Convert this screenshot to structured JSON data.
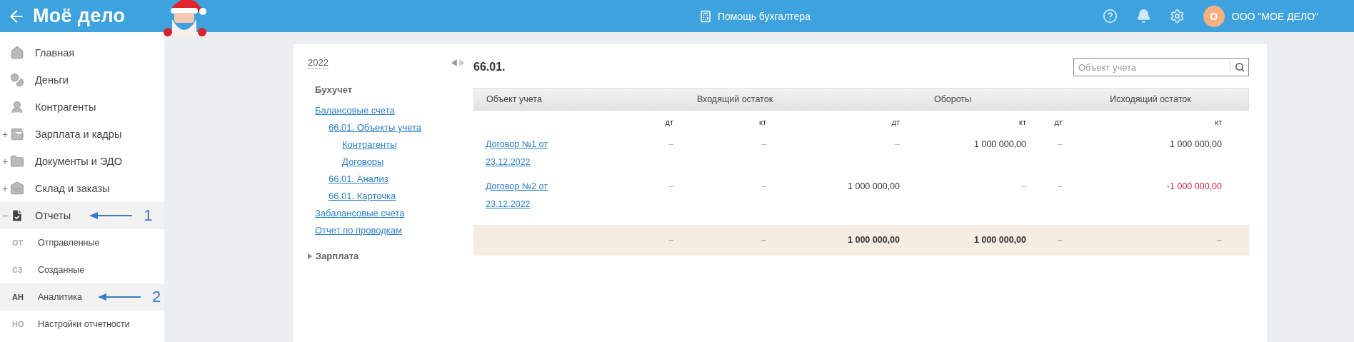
{
  "header": {
    "logo": "Моё дело",
    "center_title": "Помощь бухгалтера",
    "avatar_letter": "О",
    "company": "ООО \"МОЕ ДЕЛО\""
  },
  "sidebar": {
    "items": [
      {
        "kind": "home",
        "label": "Главная",
        "selected": false
      },
      {
        "kind": "money",
        "label": "Деньги",
        "selected": false
      },
      {
        "kind": "person",
        "label": "Контрагенты",
        "selected": false
      },
      {
        "kind": "wallet",
        "label": "Зарплата и кадры",
        "expander": "+",
        "selected": false
      },
      {
        "kind": "folder",
        "label": "Документы и ЭДО",
        "expander": "+",
        "selected": false
      },
      {
        "kind": "store",
        "label": "Склад и заказы",
        "expander": "+",
        "selected": false
      },
      {
        "kind": "report",
        "label": "Отчеты",
        "expander": "−",
        "selected": true,
        "annotation": "1"
      }
    ],
    "subitems": [
      {
        "abbr": "ОТ",
        "label": "Отправленные",
        "selected": false
      },
      {
        "abbr": "СЗ",
        "label": "Созданные",
        "selected": false
      },
      {
        "abbr": "АН",
        "label": "Аналитика",
        "selected": true,
        "annotation": "2"
      },
      {
        "abbr": "НО",
        "label": "Настройки отчетности",
        "selected": false
      }
    ]
  },
  "report_nav": {
    "year": "2022",
    "section": "Бухучет",
    "links": [
      {
        "label": "Балансовые счета",
        "children": [
          {
            "label": "66.01. Объекты учета",
            "children": [
              {
                "label": "Контрагенты"
              },
              {
                "label": "Договоры"
              }
            ]
          },
          {
            "label": "66.01. Анализ"
          },
          {
            "label": "66.01. Карточка"
          }
        ]
      },
      {
        "label": "Забалансовые счета"
      },
      {
        "label": "Отчет по проводкам"
      }
    ],
    "collapsed_section": "Зарплата"
  },
  "report": {
    "title": "66.01.",
    "search": {
      "placeholder": "Объект учета"
    },
    "table": {
      "columns": [
        "Объект учета",
        "Входящий остаток",
        "Обороты",
        "Исходящий остаток"
      ],
      "subcolumns": [
        "дт",
        "кт",
        "дт",
        "кт",
        "дт",
        "кт"
      ],
      "rows": [
        {
          "kind": "item",
          "object": "Договор №1 от 23.12.2022",
          "cells": [
            {
              "text": "–",
              "dimmed": true,
              "negative": false
            },
            {
              "text": "–",
              "dimmed": true,
              "negative": false
            },
            {
              "text": "–",
              "dimmed": true,
              "negative": false
            },
            {
              "text": "1 000 000,00",
              "dimmed": false,
              "negative": false
            },
            {
              "text": "–",
              "dimmed": true,
              "negative": false
            },
            {
              "text": "1 000 000,00",
              "dimmed": false,
              "negative": false
            }
          ]
        },
        {
          "kind": "item",
          "object": "Договор №2 от 23.12.2022",
          "cells": [
            {
              "text": "–",
              "dimmed": true,
              "negative": false
            },
            {
              "text": "–",
              "dimmed": true,
              "negative": false
            },
            {
              "text": "1 000 000,00",
              "dimmed": false,
              "negative": false
            },
            {
              "text": "–",
              "dimmed": true,
              "negative": false
            },
            {
              "text": "–",
              "dimmed": true,
              "negative": false
            },
            {
              "text": "-1 000 000,00",
              "dimmed": false,
              "negative": true
            }
          ]
        },
        {
          "kind": "total",
          "cells": [
            {
              "text": "–",
              "dimmed": true,
              "negative": false
            },
            {
              "text": "–",
              "dimmed": true,
              "negative": false
            },
            {
              "text": "1 000 000,00",
              "dimmed": false,
              "negative": false
            },
            {
              "text": "1 000 000,00",
              "dimmed": false,
              "negative": false
            },
            {
              "text": "–",
              "dimmed": true,
              "negative": false
            },
            {
              "text": "–",
              "dimmed": true,
              "negative": false
            }
          ]
        }
      ]
    }
  }
}
